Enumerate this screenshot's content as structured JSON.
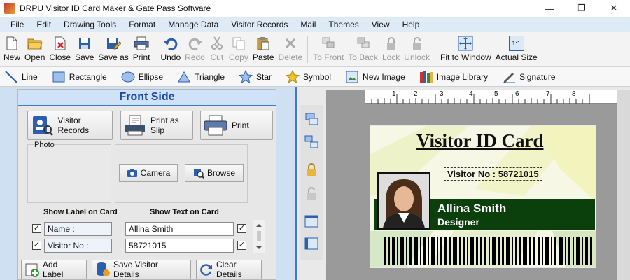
{
  "app": {
    "title": "DRPU Visitor ID Card Maker & Gate Pass Software"
  },
  "window": {
    "minimize": "—",
    "restore": "❐",
    "close": "✕"
  },
  "menu": [
    "File",
    "Edit",
    "Drawing Tools",
    "Format",
    "Manage Data",
    "Visitor Records",
    "Mail",
    "Themes",
    "View",
    "Help"
  ],
  "toolbar": {
    "new": "New",
    "open": "Open",
    "close": "Close",
    "save": "Save",
    "save_as": "Save as",
    "print": "Print",
    "undo": "Undo",
    "redo": "Redo",
    "cut": "Cut",
    "copy": "Copy",
    "paste": "Paste",
    "delete": "Delete",
    "to_front": "To Front",
    "to_back": "To Back",
    "lock": "Lock",
    "unlock": "Unlock",
    "fit": "Fit to Window",
    "actual": "Actual Size",
    "actual_icon": "1:1"
  },
  "drawbar": {
    "line": "Line",
    "rectangle": "Rectangle",
    "ellipse": "Ellipse",
    "triangle": "Triangle",
    "star": "Star",
    "symbol": "Symbol",
    "new_image": "New Image",
    "image_library": "Image Library",
    "signature": "Signature"
  },
  "panel": {
    "title": "Front Side",
    "visitor_records": "Visitor Records",
    "print_slip": "Print as Slip",
    "print": "Print",
    "photo": "Photo",
    "camera": "Camera",
    "browse": "Browse",
    "show_label": "Show Label on Card",
    "show_text": "Show Text on Card",
    "rows": [
      {
        "label": "Name :",
        "text": "Allina Smith"
      },
      {
        "label": "Visitor No :",
        "text": "58721015"
      }
    ],
    "add_label": "Add Label",
    "save_details": "Save Visitor Details",
    "clear_details": "Clear Details"
  },
  "ruler": [
    "1",
    "2",
    "3",
    "4",
    "5",
    "6",
    "7",
    "8"
  ],
  "card": {
    "title": "Visitor ID Card",
    "visitor_no": "Visitor No :  58721015",
    "name": "Allina Smith",
    "designation": "Designer"
  },
  "colors": {
    "accent": "#3f7ad0",
    "title_blue": "#1b4aa6",
    "card_band": "#0b3f0b"
  }
}
